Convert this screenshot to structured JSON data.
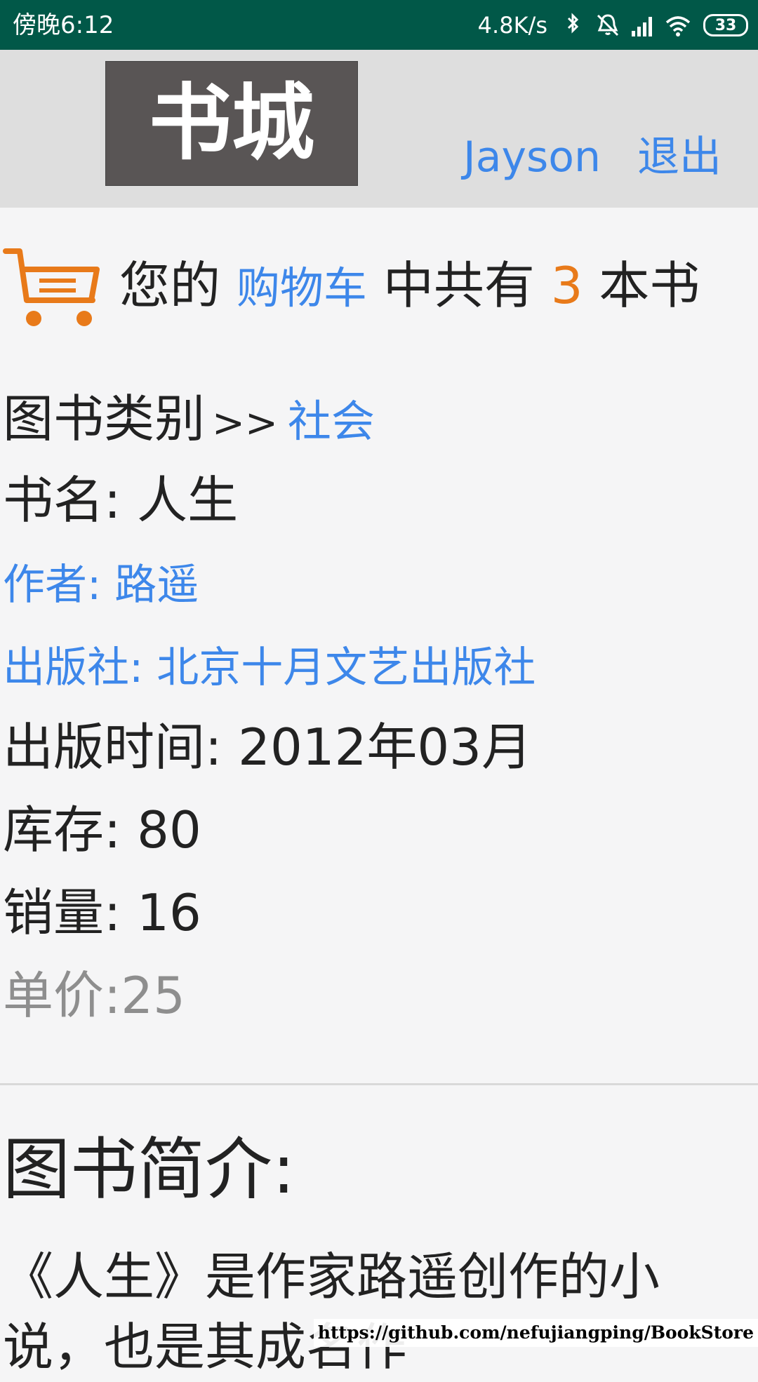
{
  "status_bar": {
    "time": "傍晚6:12",
    "speed": "4.8K/s",
    "battery": "33"
  },
  "header": {
    "logo_text": "书城",
    "user": "Jayson",
    "logout": "退出"
  },
  "cart": {
    "prefix": "您的",
    "link": "购物车",
    "middle": "中共有",
    "count": "3",
    "suffix": "本书"
  },
  "book": {
    "category_label": "图书类别",
    "category_arrow": ">>",
    "category": "社会",
    "title_line": "书名: 人生",
    "author_line": "作者: 路遥",
    "press_line": "出版社: 北京十月文艺出版社",
    "date_line": "出版时间: 2012年03月",
    "stock_line": "库存: 80",
    "sales_line": "销量: 16",
    "price_line": "单价:25"
  },
  "intro": {
    "title": "图书简介:",
    "text": "《人生》是作家路遥创作的小说，也是其成名作"
  },
  "watermark": "https://github.com/nefujiangping/BookStore",
  "colors": {
    "status_bar": "#015848",
    "header_bg": "#dedede",
    "link": "#3d87ea",
    "accent": "#e87a1a"
  }
}
